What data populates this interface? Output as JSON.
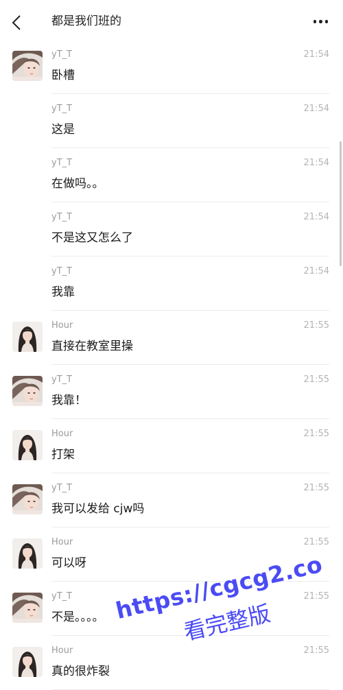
{
  "header": {
    "title": "都是我们班的",
    "back_icon": "chevron-left-icon",
    "more_icon": "more-dots-icon"
  },
  "messages": [
    {
      "sender": "yT_T",
      "time": "21:54",
      "text": "卧槽",
      "avatar": "yt"
    },
    {
      "sender": "yT_T",
      "time": "21:54",
      "text": "这是",
      "avatar": null
    },
    {
      "sender": "yT_T",
      "time": "21:54",
      "text": "在做吗。。",
      "avatar": null
    },
    {
      "sender": "yT_T",
      "time": "21:54",
      "text": "不是这又怎么了",
      "avatar": null
    },
    {
      "sender": "yT_T",
      "time": "21:54",
      "text": "我靠",
      "avatar": null
    },
    {
      "sender": "Hour",
      "time": "21:55",
      "text": "直接在教室里操",
      "avatar": "hour"
    },
    {
      "sender": "yT_T",
      "time": "21:55",
      "text": "我靠！",
      "avatar": "yt"
    },
    {
      "sender": "Hour",
      "time": "21:55",
      "text": "打架",
      "avatar": "hour"
    },
    {
      "sender": "yT_T",
      "time": "21:55",
      "text": "我可以发给 cjw吗",
      "avatar": "yt"
    },
    {
      "sender": "Hour",
      "time": "21:55",
      "text": "可以呀",
      "avatar": "hour"
    },
    {
      "sender": "yT_T",
      "time": "21:55",
      "text": "不是。。。。",
      "avatar": "yt"
    },
    {
      "sender": "Hour",
      "time": "21:55",
      "text": "真的很炸裂",
      "avatar": "hour"
    }
  ],
  "watermark": {
    "url": "https://cgcg2.co",
    "text": "看完整版",
    "color": "#4b4bf5"
  }
}
